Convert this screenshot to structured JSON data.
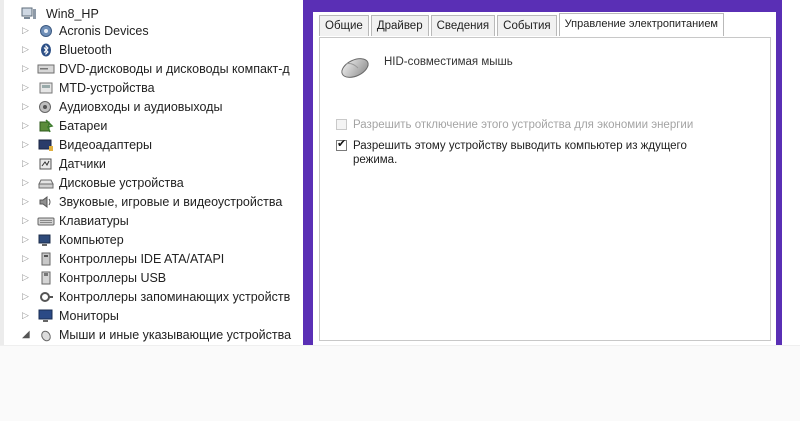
{
  "tree": {
    "root": {
      "label": "Win8_HP"
    },
    "items": [
      {
        "label": "Acronis Devices",
        "icon": "acronis-icon"
      },
      {
        "label": "Bluetooth",
        "icon": "bluetooth-icon"
      },
      {
        "label": "DVD-дисководы и дисководы компакт-д",
        "icon": "dvd-drive-icon"
      },
      {
        "label": "MTD-устройства",
        "icon": "mtd-device-icon"
      },
      {
        "label": "Аудиовходы и аудиовыходы",
        "icon": "audio-io-icon"
      },
      {
        "label": "Батареи",
        "icon": "battery-icon"
      },
      {
        "label": "Видеоадаптеры",
        "icon": "video-adapter-icon"
      },
      {
        "label": "Датчики",
        "icon": "sensor-icon"
      },
      {
        "label": "Дисковые устройства",
        "icon": "disk-drive-icon"
      },
      {
        "label": "Звуковые, игровые и видеоустройства",
        "icon": "sound-device-icon"
      },
      {
        "label": "Клавиатуры",
        "icon": "keyboard-icon"
      },
      {
        "label": "Компьютер",
        "icon": "computer-icon"
      },
      {
        "label": "Контроллеры IDE ATA/ATAPI",
        "icon": "ide-controller-icon"
      },
      {
        "label": "Контроллеры USB",
        "icon": "usb-controller-icon"
      },
      {
        "label": "Контроллеры запоминающих устройств",
        "icon": "storage-controller-icon"
      },
      {
        "label": "Мониторы",
        "icon": "monitor-icon"
      },
      {
        "label": "Мыши и иные указывающие устройства",
        "icon": "mouse-icon",
        "expanded": true
      }
    ]
  },
  "dialog": {
    "tabs": [
      {
        "label": "Общие",
        "active": false
      },
      {
        "label": "Драйвер",
        "active": false
      },
      {
        "label": "Сведения",
        "active": false
      },
      {
        "label": "События",
        "active": false
      },
      {
        "label": "Управление электропитанием",
        "active": true
      }
    ],
    "device_name": "HID-совместимая мышь",
    "device_icon": "mouse-icon",
    "options": [
      {
        "label": "Разрешить отключение этого устройства для экономии энергии",
        "checked": false,
        "enabled": false
      },
      {
        "label": "Разрешить этому устройству выводить компьютер из ждущего режима.",
        "checked": true,
        "enabled": true
      }
    ]
  },
  "colors": {
    "dialog_frame": "#5a2fb5",
    "tab_border": "#b9b9b9",
    "disabled_text": "#a4a4a4"
  }
}
